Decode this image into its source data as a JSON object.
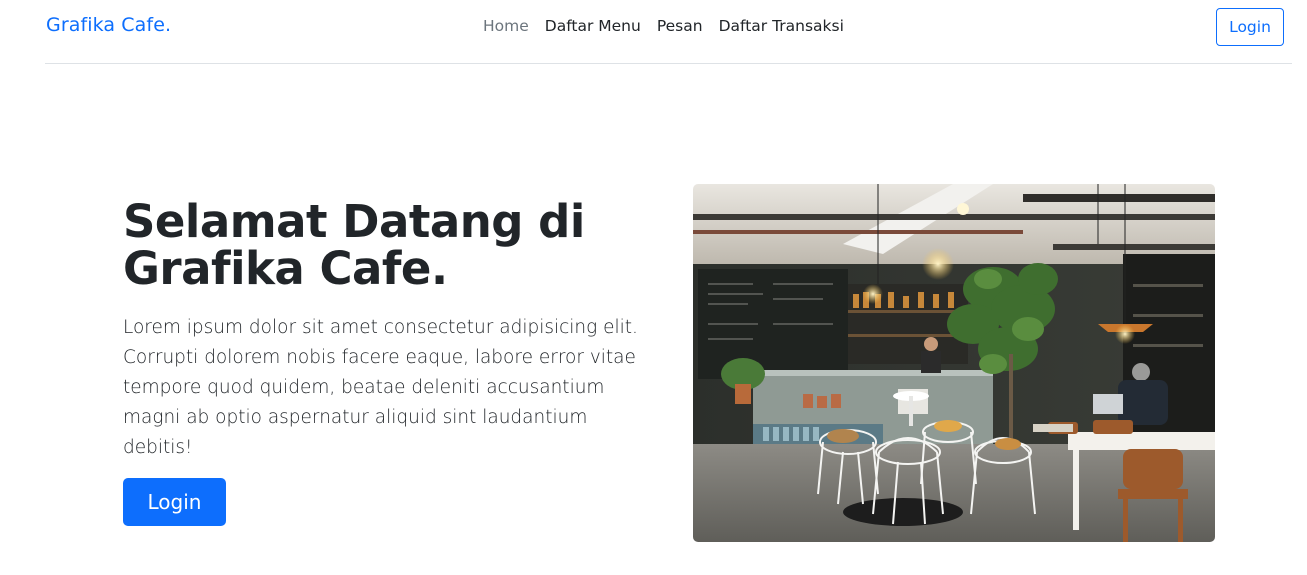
{
  "navbar": {
    "brand": "Grafika Cafe.",
    "links": [
      {
        "label": "Home",
        "active": true
      },
      {
        "label": "Daftar Menu",
        "active": false
      },
      {
        "label": "Pesan",
        "active": false
      },
      {
        "label": "Daftar Transaksi",
        "active": false
      }
    ],
    "login_label": "Login"
  },
  "hero": {
    "title_line1": "Selamat Datang di",
    "title_line2": "Grafika Cafe.",
    "description": "Lorem ipsum dolor sit amet consectetur adipisicing elit. Corrupti dolorem nobis facere eaque, labore error vitae tempore quod quidem, beatae deleniti accusantium magni ab optio aspernatur aliquid sint laudantium debitis!",
    "login_label": "Login",
    "image_alt": "cafe interior photo"
  },
  "colors": {
    "primary": "#0d6efd",
    "text": "#212529",
    "muted": "#6c757d"
  }
}
